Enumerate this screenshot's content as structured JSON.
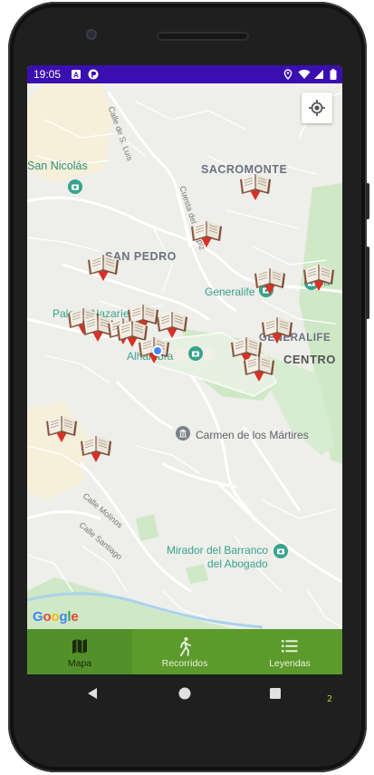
{
  "status_bar": {
    "time": "19:05",
    "left_icons": [
      "a-icon",
      "p-icon"
    ],
    "right_icons": [
      "location-icon",
      "wifi-icon",
      "signal-icon",
      "battery-icon"
    ]
  },
  "map": {
    "labels": {
      "calle_s_luis": "Calle de S. Luis",
      "san_nicolas": "San Nicolás",
      "sacromonte": "SACROMONTE",
      "cuesta_chapiz": "Cuesta del Chapiz",
      "san_pedro": "SAN PEDRO",
      "generalife_poi": "Generalife",
      "generalife_area": "GENERALIFE",
      "centro": "CENTRO",
      "palacio_nazaries": "Palacio Nazaríes",
      "alhambra": "Alhambra",
      "carmen_martires": "Carmen de los Mártires",
      "calle_molinos": "Calle Molinos",
      "calle_santiago": "Calle Santiago",
      "mirador_line1": "Mirador del Barranco",
      "mirador_line2": "del Abogado",
      "partial_alla": "lla"
    },
    "google_logo": [
      "G",
      "o",
      "o",
      "g",
      "l",
      "e"
    ],
    "colors": {
      "park_green": "#cfe8c6",
      "poi_teal": "#37a38c",
      "location_blue": "#4285f4"
    }
  },
  "locate_button": {
    "icon": "my-location-icon"
  },
  "bottom_nav": {
    "items": [
      {
        "label": "Mapa",
        "icon": "map-icon",
        "active": true
      },
      {
        "label": "Recorridos",
        "icon": "walking-icon",
        "active": false
      },
      {
        "label": "Leyendas",
        "icon": "list-icon",
        "active": false
      }
    ]
  },
  "system_nav": {
    "back": "back-icon",
    "home": "home-icon",
    "recents": "recents-icon"
  },
  "corner_indicator": "2"
}
